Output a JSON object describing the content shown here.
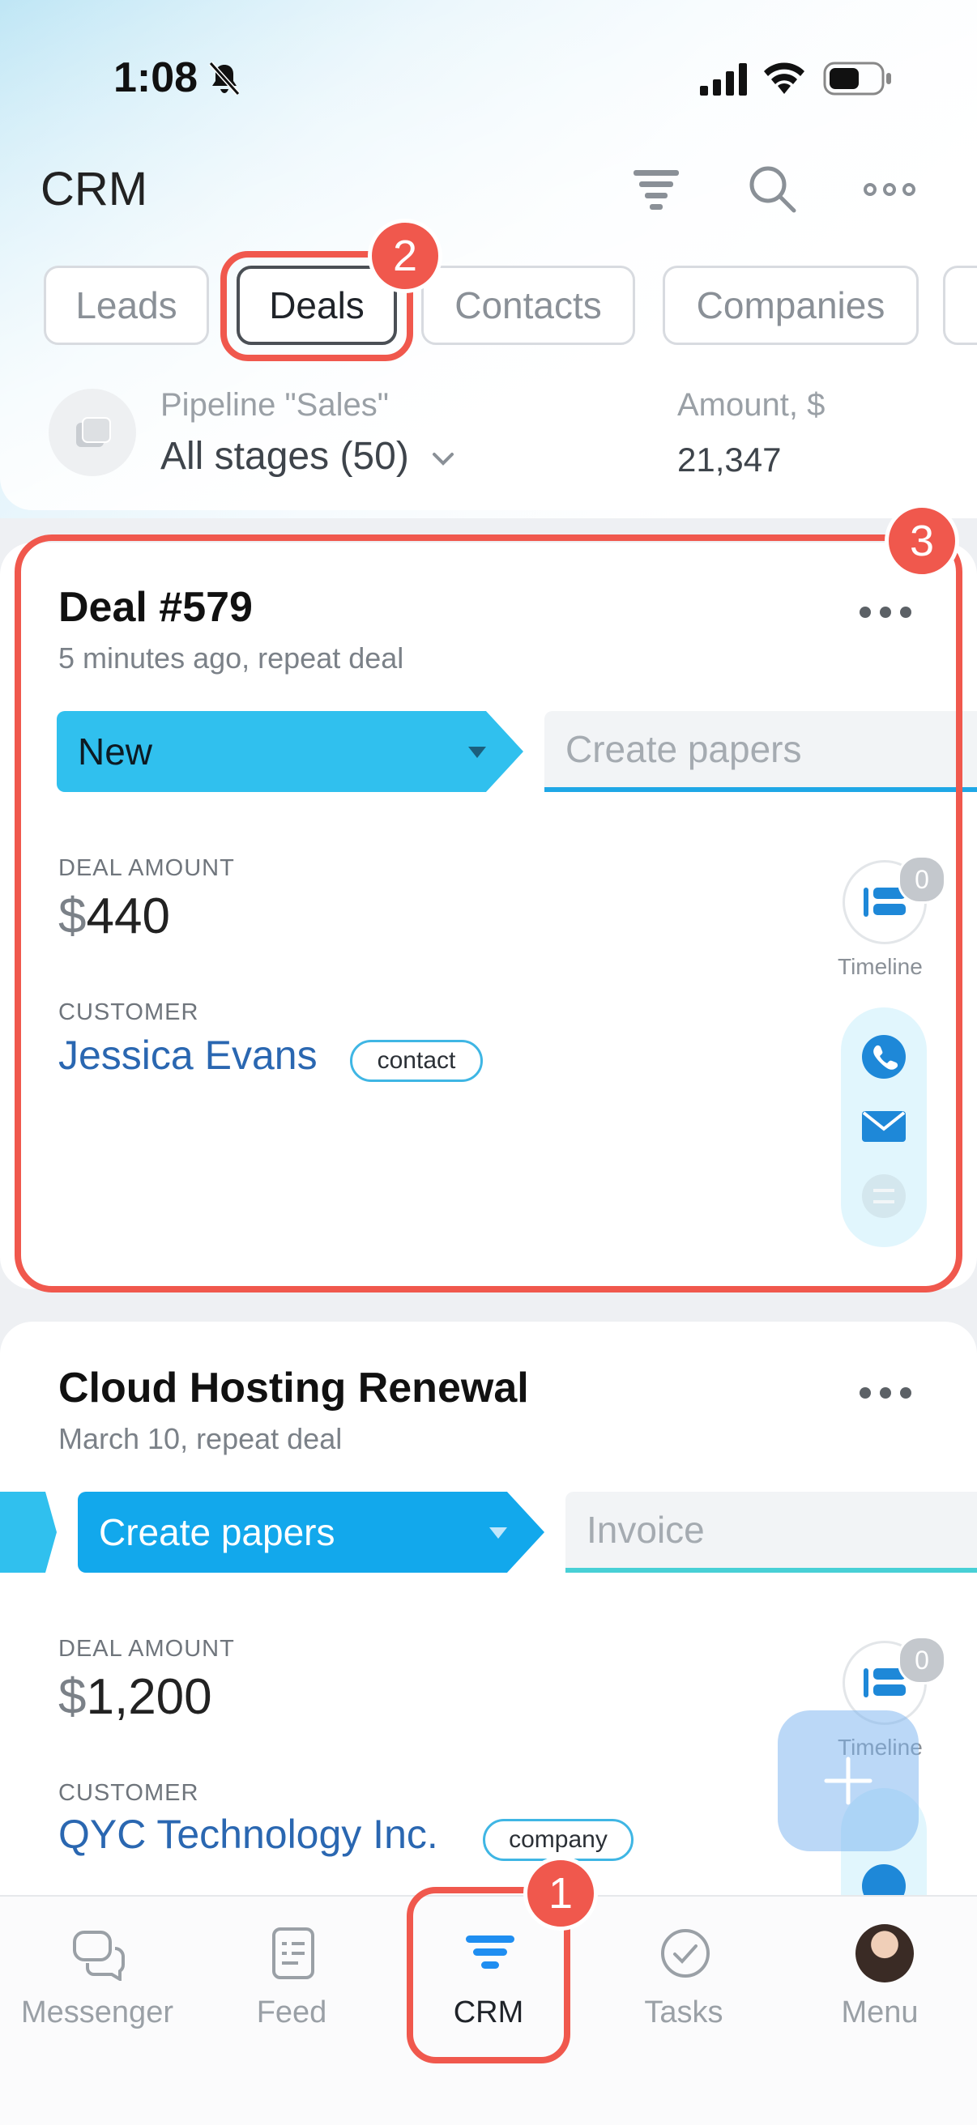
{
  "status_bar": {
    "time": "1:08"
  },
  "header": {
    "title": "CRM"
  },
  "tabs": [
    {
      "label": "Leads"
    },
    {
      "label": "Deals"
    },
    {
      "label": "Contacts"
    },
    {
      "label": "Companies"
    }
  ],
  "pipeline": {
    "label": "Pipeline \"Sales\"",
    "value": "All stages (50)",
    "amount_label": "Amount, $",
    "amount_value": "21,347"
  },
  "deals": [
    {
      "title": "Deal #579",
      "subtitle": "5 minutes ago, repeat deal",
      "stage_current": "New",
      "stage_next": "Create papers",
      "amount_label": "DEAL AMOUNT",
      "amount_currency": "$",
      "amount": "440",
      "customer_label": "CUSTOMER",
      "customer": "Jessica Evans",
      "customer_type": "contact",
      "timeline_count": "0",
      "timeline_label": "Timeline"
    },
    {
      "title": "Cloud Hosting Renewal",
      "subtitle": "March 10, repeat deal",
      "stage_current": "Create papers",
      "stage_next": "Invoice",
      "amount_label": "DEAL AMOUNT",
      "amount_currency": "$",
      "amount": "1,200",
      "customer_label": "CUSTOMER",
      "customer": "QYC Technology Inc.",
      "customer_type": "company",
      "timeline_count": "0",
      "timeline_label": "Timeline"
    }
  ],
  "bottom_nav": [
    {
      "label": "Messenger",
      "icon": "messenger-icon"
    },
    {
      "label": "Feed",
      "icon": "feed-icon"
    },
    {
      "label": "CRM",
      "icon": "crm-icon"
    },
    {
      "label": "Tasks",
      "icon": "tasks-icon"
    },
    {
      "label": "Menu",
      "icon": "avatar"
    }
  ],
  "annotations": [
    "1",
    "2",
    "3"
  ],
  "colors": {
    "accent": "#30c0ee",
    "link": "#2a67b1",
    "highlight": "#f0584d"
  }
}
